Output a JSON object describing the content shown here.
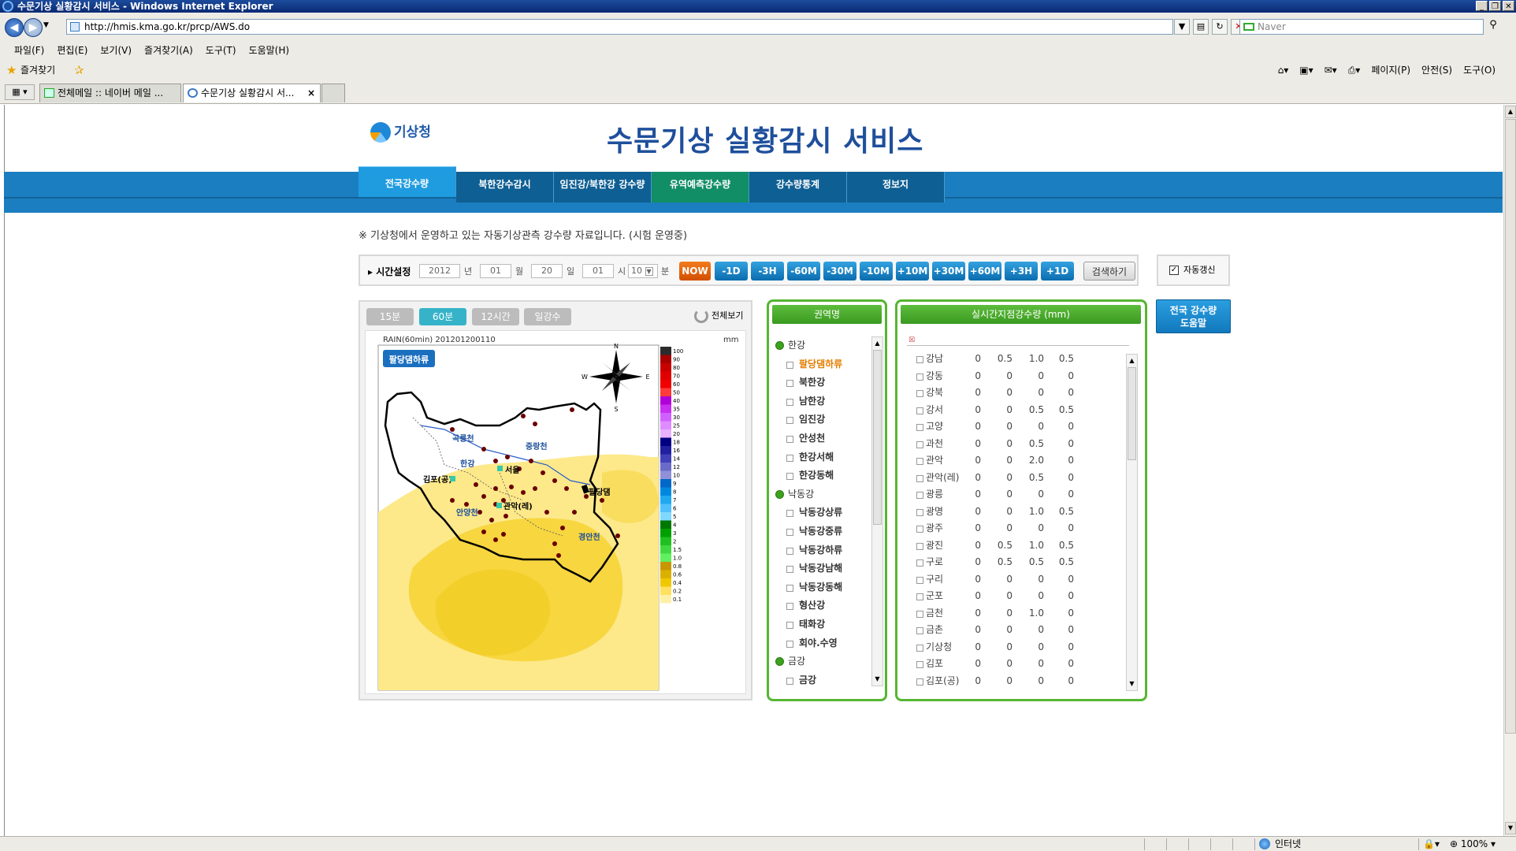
{
  "window": {
    "title": "수문기상 실황감시 서비스 - Windows Internet Explorer"
  },
  "browser": {
    "url": "http://hmis.kma.go.kr/prcp/AWS.do",
    "search_placeholder": "Naver",
    "menu": [
      "파일(F)",
      "편집(E)",
      "보기(V)",
      "즐겨찾기(A)",
      "도구(T)",
      "도움말(H)"
    ],
    "favorites_label": "즐겨찾기",
    "command_bar": [
      "페이지(P)",
      "안전(S)",
      "도구(O)"
    ],
    "tabs": [
      {
        "label": "전체메일 :: 네이버 메일 ..."
      },
      {
        "label": "수문기상 실황감시 서..."
      }
    ]
  },
  "status": {
    "zone": "인터넷",
    "zoom": "100%"
  },
  "page": {
    "logo": "기상청",
    "title": "수문기상 실황감시 서비스",
    "nav": [
      "전국강수량",
      "북한강수감시",
      "임진강/북한강 강수량",
      "유역예측강수량",
      "강수량통계",
      "정보지"
    ],
    "notice": "※ 기상청에서 운영하고 있는 자동기상관측 강수량 자료입니다. (시험 운영중)",
    "time": {
      "label": "시간설정",
      "year": "2012",
      "year_unit": "년",
      "month": "01",
      "month_unit": "월",
      "day": "20",
      "day_unit": "일",
      "hour": "01",
      "hour_unit": "시",
      "minute": "10",
      "minute_unit": "분",
      "buttons": [
        "NOW",
        "-1D",
        "-3H",
        "-60M",
        "-30M",
        "-10M",
        "+10M",
        "+30M",
        "+60M",
        "+3H",
        "+1D"
      ],
      "search_btn": "검색하기",
      "auto_refresh": "자동갱신"
    },
    "map": {
      "tabs": [
        "15분",
        "60분",
        "12시간",
        "일강수"
      ],
      "full_view": "전체보기",
      "caption": "RAIN(60min)   201201200110",
      "unit": "mm",
      "region_label": "팔당댐하류",
      "scale": [
        "100",
        "90",
        "80",
        "70",
        "60",
        "50",
        "40",
        "35",
        "30",
        "25",
        "20",
        "18",
        "16",
        "14",
        "12",
        "10",
        "9",
        "8",
        "7",
        "6",
        "5",
        "4",
        "3",
        "2",
        "1.5",
        "1.0",
        "0.8",
        "0.6",
        "0.4",
        "0.2",
        "0.1"
      ],
      "scale_colors": [
        "#2b2b2b",
        "#a80000",
        "#c80000",
        "#e00000",
        "#f00000",
        "#ff3a3a",
        "#b000d8",
        "#c830f0",
        "#d060ff",
        "#de8cff",
        "#e8b0ff",
        "#000080",
        "#2020a0",
        "#4040b8",
        "#6a6ac8",
        "#9090d8",
        "#0068c8",
        "#0088e0",
        "#20a8f0",
        "#50c0ff",
        "#80d8ff",
        "#007800",
        "#00a000",
        "#20c020",
        "#40d840",
        "#60f060",
        "#c89600",
        "#dcb000",
        "#f0c800",
        "#ffe060",
        "#fff0a8"
      ],
      "places": [
        "곡릉천",
        "중랑천",
        "한강",
        "서울",
        "김포(공)",
        "관악(레)",
        "안양천",
        "팔당댐",
        "경안천"
      ],
      "compass": [
        "N",
        "S",
        "W",
        "E"
      ]
    },
    "regions": {
      "header": "권역명",
      "items": [
        {
          "label": "한강",
          "type": "grp"
        },
        {
          "label": "팔당댐하류",
          "type": "sub",
          "selected": true
        },
        {
          "label": "북한강",
          "type": "sub"
        },
        {
          "label": "남한강",
          "type": "sub"
        },
        {
          "label": "임진강",
          "type": "sub"
        },
        {
          "label": "안성천",
          "type": "sub"
        },
        {
          "label": "한강서해",
          "type": "sub"
        },
        {
          "label": "한강동해",
          "type": "sub"
        },
        {
          "label": "낙동강",
          "type": "grp"
        },
        {
          "label": "낙동강상류",
          "type": "sub"
        },
        {
          "label": "낙동강중류",
          "type": "sub"
        },
        {
          "label": "낙동강하류",
          "type": "sub"
        },
        {
          "label": "낙동강남해",
          "type": "sub"
        },
        {
          "label": "낙동강동해",
          "type": "sub"
        },
        {
          "label": "형산강",
          "type": "sub"
        },
        {
          "label": "태화강",
          "type": "sub"
        },
        {
          "label": "회야.수영",
          "type": "sub"
        },
        {
          "label": "금강",
          "type": "grp"
        },
        {
          "label": "금강",
          "type": "sub"
        }
      ]
    },
    "stations": {
      "header": "실시간지점강수량 (mm)",
      "rows": [
        {
          "name": "강남",
          "v": [
            "0",
            "0.5",
            "1.0",
            "0.5"
          ]
        },
        {
          "name": "강동",
          "v": [
            "0",
            "0",
            "0",
            "0"
          ]
        },
        {
          "name": "강북",
          "v": [
            "0",
            "0",
            "0",
            "0"
          ]
        },
        {
          "name": "강서",
          "v": [
            "0",
            "0",
            "0.5",
            "0.5"
          ]
        },
        {
          "name": "고양",
          "v": [
            "0",
            "0",
            "0",
            "0"
          ]
        },
        {
          "name": "과천",
          "v": [
            "0",
            "0",
            "0.5",
            "0"
          ]
        },
        {
          "name": "관악",
          "v": [
            "0",
            "0",
            "2.0",
            "0"
          ]
        },
        {
          "name": "관악(레)",
          "v": [
            "0",
            "0",
            "0.5",
            "0"
          ]
        },
        {
          "name": "광릉",
          "v": [
            "0",
            "0",
            "0",
            "0"
          ]
        },
        {
          "name": "광명",
          "v": [
            "0",
            "0",
            "1.0",
            "0.5"
          ]
        },
        {
          "name": "광주",
          "v": [
            "0",
            "0",
            "0",
            "0"
          ]
        },
        {
          "name": "광진",
          "v": [
            "0",
            "0.5",
            "1.0",
            "0.5"
          ]
        },
        {
          "name": "구로",
          "v": [
            "0",
            "0.5",
            "0.5",
            "0.5"
          ]
        },
        {
          "name": "구리",
          "v": [
            "0",
            "0",
            "0",
            "0"
          ]
        },
        {
          "name": "군포",
          "v": [
            "0",
            "0",
            "0",
            "0"
          ]
        },
        {
          "name": "금천",
          "v": [
            "0",
            "0",
            "1.0",
            "0"
          ]
        },
        {
          "name": "금촌",
          "v": [
            "0",
            "0",
            "0",
            "0"
          ]
        },
        {
          "name": "기상청",
          "v": [
            "0",
            "0",
            "0",
            "0"
          ]
        },
        {
          "name": "김포",
          "v": [
            "0",
            "0",
            "0",
            "0"
          ]
        },
        {
          "name": "김포(공)",
          "v": [
            "0",
            "0",
            "0",
            "0"
          ]
        }
      ]
    },
    "help_btn": [
      "전국 강수량",
      "도움말"
    ]
  }
}
